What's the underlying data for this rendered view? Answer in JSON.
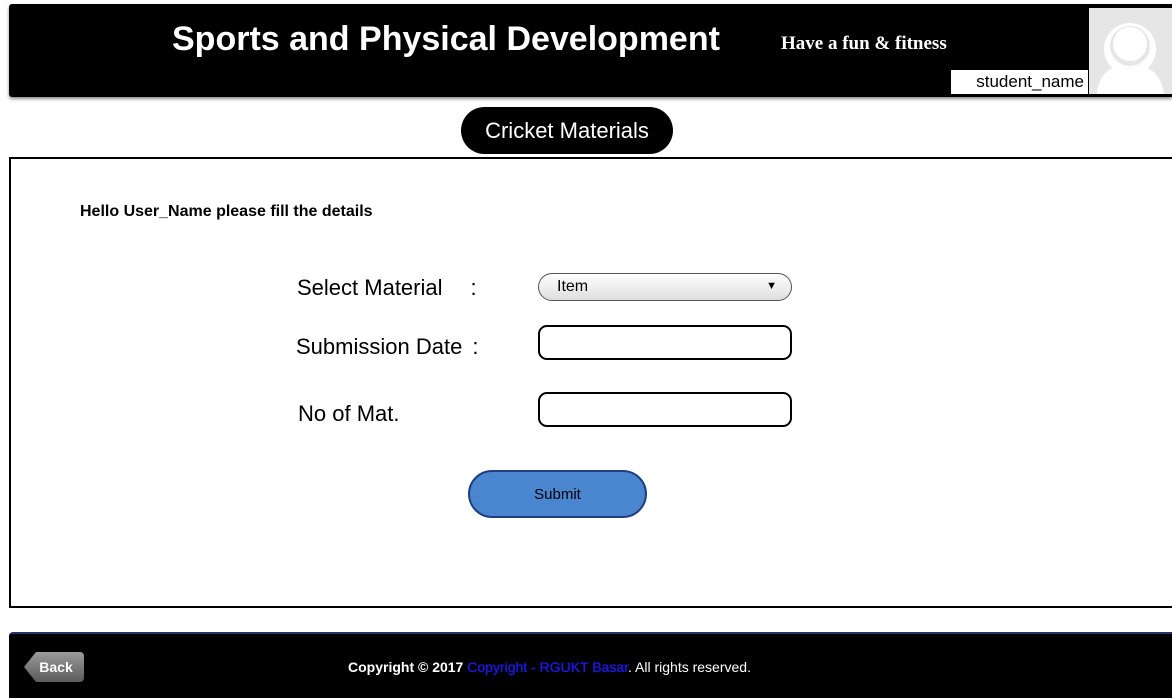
{
  "header": {
    "title": "Sports and Physical Development",
    "tagline": "Have a fun & fitness",
    "student_name": "student_name",
    "avatar_icon": "user-avatar-icon"
  },
  "page_heading": "Cricket Materials",
  "form": {
    "greeting": "Hello User_Name please fill the details",
    "material_label": "Select Material",
    "material_colon": ":",
    "material_selected": "Item",
    "date_label": "Submission Date",
    "date_colon": ":",
    "date_value": "",
    "count_label": "No of Mat.",
    "count_value": "",
    "submit_label": "Submit"
  },
  "footer": {
    "back_label": "Back",
    "copyright_prefix": "Copyright © 2017",
    "copyright_link": "Copyright - RGUKT Basar",
    "copyright_suffix": ". All rights reserved."
  },
  "colors": {
    "header_bg": "#000000",
    "submit_bg": "#4a86d0",
    "link": "#1d1ae0"
  }
}
